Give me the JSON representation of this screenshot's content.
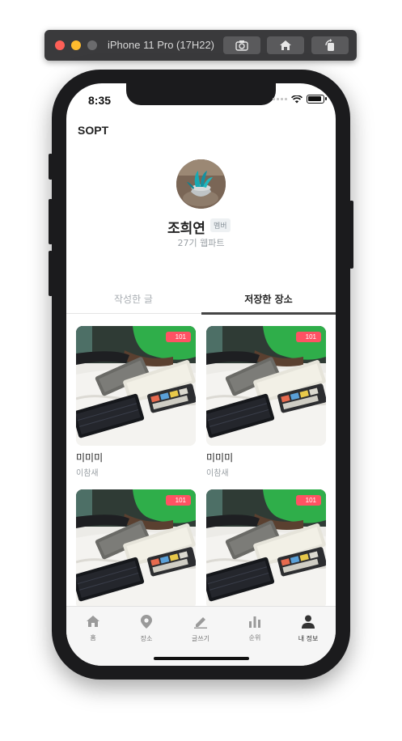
{
  "simulator": {
    "title": "iPhone 11 Pro (17H22)",
    "buttons": [
      "screenshot-icon",
      "home-icon",
      "rotate-icon"
    ]
  },
  "status_bar": {
    "time": "8:35"
  },
  "app": {
    "title": "SOPT"
  },
  "profile": {
    "name": "조희연",
    "role_badge": "멤버",
    "generation": "27기 웹파트"
  },
  "tabs": [
    {
      "label": "작성한 글",
      "active": false
    },
    {
      "label": "저장한 장소",
      "active": true
    }
  ],
  "saved_places": [
    {
      "title": "미미미",
      "author": "이참새",
      "count": "101"
    },
    {
      "title": "미미미",
      "author": "이참새",
      "count": "101"
    },
    {
      "title": "",
      "author": "",
      "count": "101"
    },
    {
      "title": "",
      "author": "",
      "count": "101"
    }
  ],
  "bottom_nav": [
    {
      "label": "홈",
      "icon": "home-icon",
      "active": false
    },
    {
      "label": "장소",
      "icon": "map-pin-icon",
      "active": false
    },
    {
      "label": "글쓰기",
      "icon": "pencil-icon",
      "active": false
    },
    {
      "label": "순위",
      "icon": "bar-chart-icon",
      "active": false
    },
    {
      "label": "내 정보",
      "icon": "person-icon",
      "active": true
    }
  ],
  "colors": {
    "accent_badge": "#ff5263",
    "active_tab_indicator": "#444444"
  }
}
